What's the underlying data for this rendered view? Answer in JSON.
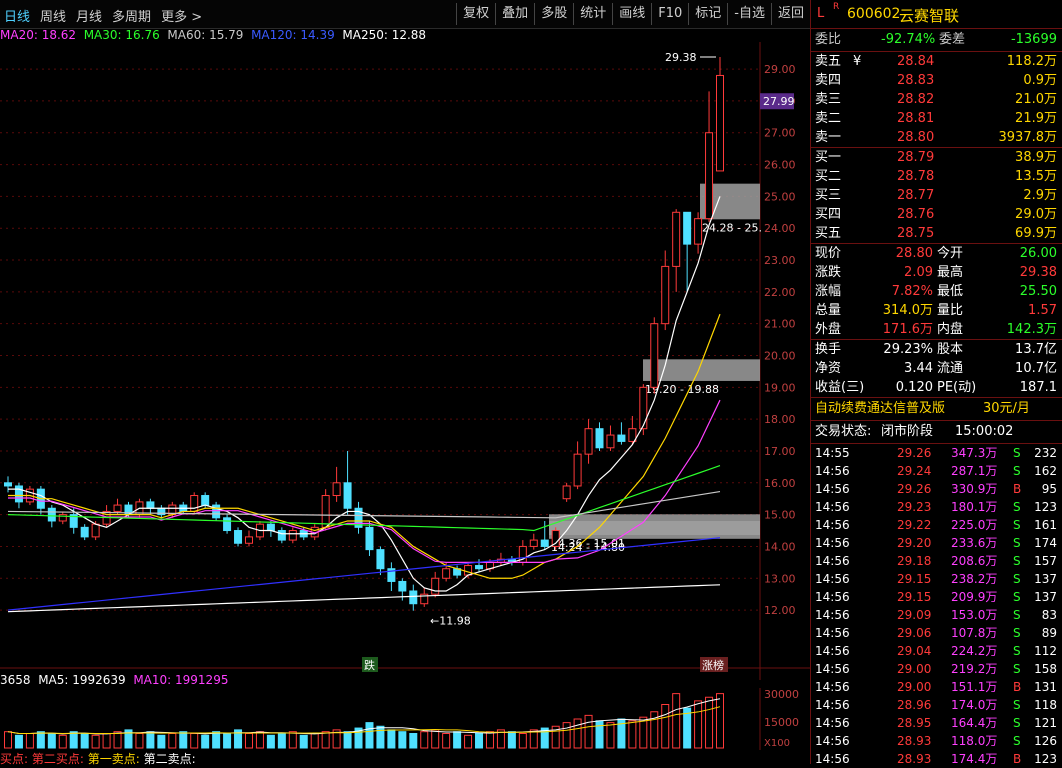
{
  "toolbar": {
    "periods": [
      "日线",
      "周线",
      "月线",
      "多周期",
      "更多 >"
    ],
    "actions": [
      "复权",
      "叠加",
      "多股",
      "统计",
      "画线",
      "F10",
      "标记",
      "-自选",
      "返回"
    ]
  },
  "ma_legend": {
    "ma20": "MA20: 18.62",
    "ma30": "MA30: 16.76",
    "ma60": "MA60: 15.79",
    "ma120": "MA120: 14.39",
    "ma250": "MA250: 12.88"
  },
  "colors": {
    "up": "#ff3a3a",
    "down": "#4fe0ff",
    "ma20": "#ff40ff",
    "ma30": "#2bff2b",
    "ma60": "#c8c8c8",
    "ma120": "#3030ff",
    "ma250": "#ffffff"
  },
  "chart_data": {
    "type": "candlestick",
    "y_axis_ticks": [
      "29.00",
      "28.00",
      "27.00",
      "26.00",
      "25.00",
      "24.00",
      "23.00",
      "22.00",
      "21.00",
      "20.00",
      "19.00",
      "18.00",
      "17.00",
      "16.00",
      "15.00",
      "14.00",
      "13.00",
      "12.00"
    ],
    "ylim": [
      11.5,
      29.6
    ],
    "current_price_tag": "27.99",
    "high_label": "29.38",
    "low_label": "11.98",
    "zones": [
      {
        "label": "24.28 - 25.",
        "low": 24.28,
        "high": 25.4
      },
      {
        "label": "19.20 - 19.88",
        "low": 19.2,
        "high": 19.88
      },
      {
        "label": "14.36 - 15.01",
        "low": 14.36,
        "high": 15.01
      },
      {
        "label": "14.24 - 14.80",
        "low": 14.24,
        "high": 14.8
      }
    ],
    "markers": [
      "跌",
      "涨榜"
    ],
    "candles": [
      [
        16.0,
        15.9,
        16.2,
        15.7
      ],
      [
        15.9,
        15.4,
        16.0,
        15.2
      ],
      [
        15.4,
        15.8,
        15.9,
        15.3
      ],
      [
        15.8,
        15.2,
        15.9,
        15.0
      ],
      [
        15.2,
        14.8,
        15.3,
        14.6
      ],
      [
        14.8,
        15.0,
        15.1,
        14.7
      ],
      [
        15.0,
        14.6,
        15.2,
        14.4
      ],
      [
        14.6,
        14.3,
        14.7,
        14.2
      ],
      [
        14.3,
        14.7,
        14.8,
        14.2
      ],
      [
        14.7,
        15.1,
        15.3,
        14.6
      ],
      [
        15.1,
        15.3,
        15.5,
        15.0
      ],
      [
        15.3,
        15.0,
        15.4,
        14.9
      ],
      [
        15.0,
        15.4,
        15.5,
        14.9
      ],
      [
        15.4,
        15.2,
        15.5,
        15.0
      ],
      [
        15.2,
        15.0,
        15.3,
        14.9
      ],
      [
        15.0,
        15.3,
        15.4,
        14.9
      ],
      [
        15.3,
        15.1,
        15.4,
        15.0
      ],
      [
        15.1,
        15.6,
        15.7,
        15.0
      ],
      [
        15.6,
        15.3,
        15.7,
        15.2
      ],
      [
        15.3,
        14.9,
        15.4,
        14.8
      ],
      [
        14.9,
        14.5,
        15.0,
        14.4
      ],
      [
        14.5,
        14.1,
        14.6,
        14.0
      ],
      [
        14.1,
        14.3,
        14.5,
        14.0
      ],
      [
        14.3,
        14.7,
        14.8,
        14.2
      ],
      [
        14.7,
        14.5,
        14.8,
        14.3
      ],
      [
        14.5,
        14.2,
        14.6,
        14.1
      ],
      [
        14.2,
        14.5,
        14.6,
        14.1
      ],
      [
        14.5,
        14.3,
        14.6,
        14.2
      ],
      [
        14.3,
        14.6,
        14.7,
        14.2
      ],
      [
        14.6,
        15.6,
        15.8,
        14.5
      ],
      [
        15.6,
        16.0,
        16.5,
        15.4
      ],
      [
        16.0,
        15.2,
        17.0,
        15.0
      ],
      [
        15.2,
        14.6,
        15.4,
        14.4
      ],
      [
        14.6,
        13.9,
        14.8,
        13.7
      ],
      [
        13.9,
        13.3,
        14.0,
        13.1
      ],
      [
        13.3,
        12.9,
        13.5,
        12.6
      ],
      [
        12.9,
        12.6,
        13.0,
        12.3
      ],
      [
        12.6,
        12.2,
        12.8,
        11.98
      ],
      [
        12.2,
        12.5,
        12.7,
        12.1
      ],
      [
        12.5,
        13.0,
        13.2,
        12.4
      ],
      [
        13.0,
        13.3,
        13.5,
        12.9
      ],
      [
        13.3,
        13.1,
        13.4,
        13.0
      ],
      [
        13.1,
        13.4,
        13.5,
        13.0
      ],
      [
        13.4,
        13.3,
        13.6,
        13.2
      ],
      [
        13.3,
        13.5,
        13.6,
        13.2
      ],
      [
        13.5,
        13.6,
        13.8,
        13.4
      ],
      [
        13.6,
        13.5,
        13.7,
        13.4
      ],
      [
        13.5,
        14.0,
        14.2,
        13.4
      ],
      [
        14.0,
        14.2,
        14.4,
        13.9
      ],
      [
        14.2,
        14.0,
        14.8,
        13.9
      ],
      [
        14.0,
        14.5,
        14.6,
        13.9
      ],
      [
        15.5,
        15.9,
        16.0,
        15.4
      ],
      [
        15.9,
        16.9,
        17.3,
        15.8
      ],
      [
        16.9,
        17.7,
        18.0,
        16.6
      ],
      [
        17.7,
        17.1,
        17.9,
        17.0
      ],
      [
        17.1,
        17.5,
        17.8,
        17.0
      ],
      [
        17.5,
        17.3,
        17.9,
        17.2
      ],
      [
        17.3,
        17.7,
        18.1,
        17.2
      ],
      [
        17.7,
        19.0,
        19.1,
        17.5
      ],
      [
        19.0,
        21.0,
        21.2,
        18.8
      ],
      [
        21.0,
        22.8,
        23.3,
        20.8
      ],
      [
        22.8,
        24.5,
        24.6,
        22.0
      ],
      [
        24.5,
        23.5,
        24.3,
        22.0
      ],
      [
        23.5,
        24.3,
        24.5,
        23.2
      ],
      [
        24.3,
        27.0,
        28.3,
        24.2
      ],
      [
        25.8,
        28.8,
        29.38,
        25.8
      ]
    ],
    "ma_series": {
      "MA5": [
        15.8,
        15.8,
        15.7,
        15.6,
        15.4,
        15.3,
        15.1,
        14.9,
        14.7,
        14.6,
        14.8,
        15.0,
        15.2,
        15.2,
        15.2,
        15.2,
        15.2,
        15.2,
        15.3,
        15.2,
        15.1,
        14.9,
        14.6,
        14.5,
        14.5,
        14.4,
        14.4,
        14.4,
        14.4,
        14.6,
        14.9,
        15.1,
        15.1,
        15.0,
        14.7,
        14.2,
        13.6,
        13.0,
        12.7,
        12.6,
        12.6,
        12.8,
        13.1,
        13.2,
        13.3,
        13.4,
        13.5,
        13.6,
        13.8,
        13.9,
        14.1,
        14.5,
        15.0,
        15.6,
        16.1,
        16.4,
        16.8,
        17.2,
        17.8,
        18.6,
        19.7,
        21.1,
        22.0,
        22.9,
        24.1,
        25.0
      ],
      "MA10": [
        15.6,
        15.6,
        15.6,
        15.5,
        15.5,
        15.4,
        15.3,
        15.2,
        15.1,
        15.0,
        15.0,
        15.0,
        15.0,
        15.0,
        14.9,
        15.0,
        15.1,
        15.1,
        15.2,
        15.2,
        15.2,
        15.2,
        15.1,
        15.0,
        14.9,
        14.8,
        14.7,
        14.6,
        14.5,
        14.6,
        14.7,
        14.8,
        14.8,
        14.8,
        14.7,
        14.6,
        14.3,
        14.0,
        13.8,
        13.6,
        13.4,
        13.3,
        13.2,
        13.1,
        13.0,
        13.0,
        13.0,
        13.1,
        13.3,
        13.5,
        13.6,
        13.8,
        14.0,
        14.3,
        14.6,
        15.0,
        15.4,
        15.8,
        16.2,
        16.8,
        17.4,
        18.1,
        18.8,
        19.5,
        20.4,
        21.3
      ]
    },
    "volume_scale": [
      "30000",
      "15000"
    ],
    "volume_unit": "X100",
    "volumes": [
      9,
      7,
      8,
      9,
      8,
      7,
      9,
      8,
      7,
      8,
      9,
      10,
      8,
      9,
      7,
      8,
      9,
      8,
      7,
      9,
      8,
      10,
      8,
      9,
      7,
      8,
      9,
      7,
      8,
      9,
      10,
      9,
      11,
      14,
      12,
      10,
      9,
      8,
      9,
      10,
      8,
      9,
      7,
      8,
      9,
      10,
      9,
      8,
      10,
      11,
      12,
      14,
      16,
      18,
      15,
      14,
      16,
      15,
      17,
      20,
      24,
      30,
      22,
      26,
      28,
      30
    ],
    "volume_up": [
      1,
      0,
      1,
      0,
      0,
      1,
      0,
      0,
      1,
      1,
      1,
      0,
      1,
      0,
      0,
      1,
      0,
      1,
      0,
      0,
      0,
      0,
      1,
      1,
      0,
      0,
      1,
      0,
      1,
      1,
      1,
      0,
      0,
      0,
      0,
      0,
      0,
      0,
      1,
      1,
      1,
      0,
      1,
      0,
      1,
      1,
      0,
      1,
      1,
      0,
      1,
      1,
      1,
      1,
      0,
      1,
      0,
      1,
      1,
      1,
      1,
      1,
      0,
      1,
      1,
      1
    ]
  },
  "volume_ma": {
    "vol": "3658",
    "ma5": "MA5: 1992639",
    "ma10": "MA10: 1991295"
  },
  "bottom_hint": {
    "a": "买点:",
    "b": "第二买点:",
    "c": "第一卖点:",
    "d": "第二卖点:"
  },
  "quote": {
    "code": "600602",
    "name": "云赛智联",
    "badge_l": "L",
    "badge_r": "R",
    "weibi_label": "委比",
    "weibi": "-92.74%",
    "weicha_label": "委差",
    "weicha": "-13699",
    "sell": [
      {
        "label": "卖五",
        "price": "28.84",
        "vol": "118.2万",
        "mark": "¥"
      },
      {
        "label": "卖四",
        "price": "28.83",
        "vol": "0.9万",
        "mark": ""
      },
      {
        "label": "卖三",
        "price": "28.82",
        "vol": "21.0万",
        "mark": ""
      },
      {
        "label": "卖二",
        "price": "28.81",
        "vol": "21.9万",
        "mark": ""
      },
      {
        "label": "卖一",
        "price": "28.80",
        "vol": "3937.8万",
        "mark": ""
      }
    ],
    "buy": [
      {
        "label": "买一",
        "price": "28.79",
        "vol": "38.9万"
      },
      {
        "label": "买二",
        "price": "28.78",
        "vol": "13.5万"
      },
      {
        "label": "买三",
        "price": "28.77",
        "vol": "2.9万"
      },
      {
        "label": "买四",
        "price": "28.76",
        "vol": "29.0万"
      },
      {
        "label": "买五",
        "price": "28.75",
        "vol": "69.9万"
      }
    ],
    "stats": [
      {
        "l1": "现价",
        "v1": "28.80",
        "c1": "red",
        "l2": "今开",
        "v2": "26.00",
        "c2": "green"
      },
      {
        "l1": "涨跌",
        "v1": "2.09",
        "c1": "red",
        "l2": "最高",
        "v2": "29.38",
        "c2": "red"
      },
      {
        "l1": "涨幅",
        "v1": "7.82%",
        "c1": "red",
        "l2": "最低",
        "v2": "25.50",
        "c2": "green"
      },
      {
        "l1": "总量",
        "v1": "314.0万",
        "c1": "yellow",
        "l2": "量比",
        "v2": "1.57",
        "c2": "red"
      },
      {
        "l1": "外盘",
        "v1": "171.6万",
        "c1": "red",
        "l2": "内盘",
        "v2": "142.3万",
        "c2": "green"
      }
    ],
    "stats2": [
      {
        "l1": "换手",
        "v1": "29.23%",
        "l2": "股本",
        "v2": "13.7亿"
      },
      {
        "l1": "净资",
        "v1": "3.44",
        "l2": "流通",
        "v2": "10.7亿"
      },
      {
        "l1": "收益(三)",
        "v1": "0.120",
        "l2": "PE(动)",
        "v2": "187.1"
      }
    ],
    "ad_text": "自动续费通达信普及版",
    "ad_price": "30元/月",
    "status_label": "交易状态:",
    "status_value": "闭市阶段",
    "status_time": "15:00:02",
    "ticks": [
      {
        "t": "14:55",
        "p": "29.26",
        "v": "347.3万",
        "s": "S",
        "n": "232"
      },
      {
        "t": "14:56",
        "p": "29.24",
        "v": "287.1万",
        "s": "S",
        "n": "162"
      },
      {
        "t": "14:56",
        "p": "29.26",
        "v": "330.9万",
        "s": "B",
        "n": "95"
      },
      {
        "t": "14:56",
        "p": "29.23",
        "v": "180.1万",
        "s": "S",
        "n": "123"
      },
      {
        "t": "14:56",
        "p": "29.22",
        "v": "225.0万",
        "s": "S",
        "n": "161"
      },
      {
        "t": "14:56",
        "p": "29.20",
        "v": "233.6万",
        "s": "S",
        "n": "174"
      },
      {
        "t": "14:56",
        "p": "29.18",
        "v": "208.6万",
        "s": "S",
        "n": "157"
      },
      {
        "t": "14:56",
        "p": "29.15",
        "v": "238.2万",
        "s": "S",
        "n": "137"
      },
      {
        "t": "14:56",
        "p": "29.15",
        "v": "209.9万",
        "s": "S",
        "n": "137"
      },
      {
        "t": "14:56",
        "p": "29.09",
        "v": "153.0万",
        "s": "S",
        "n": "83"
      },
      {
        "t": "14:56",
        "p": "29.06",
        "v": "107.8万",
        "s": "S",
        "n": "89"
      },
      {
        "t": "14:56",
        "p": "29.04",
        "v": "224.2万",
        "s": "S",
        "n": "112"
      },
      {
        "t": "14:56",
        "p": "29.00",
        "v": "219.2万",
        "s": "S",
        "n": "158"
      },
      {
        "t": "14:56",
        "p": "29.00",
        "v": "151.1万",
        "s": "B",
        "n": "131"
      },
      {
        "t": "14:56",
        "p": "28.96",
        "v": "174.0万",
        "s": "S",
        "n": "118"
      },
      {
        "t": "14:56",
        "p": "28.95",
        "v": "164.4万",
        "s": "S",
        "n": "121"
      },
      {
        "t": "14:56",
        "p": "28.93",
        "v": "118.0万",
        "s": "S",
        "n": "126"
      },
      {
        "t": "14:56",
        "p": "28.93",
        "v": "174.4万",
        "s": "B",
        "n": "123"
      }
    ]
  }
}
